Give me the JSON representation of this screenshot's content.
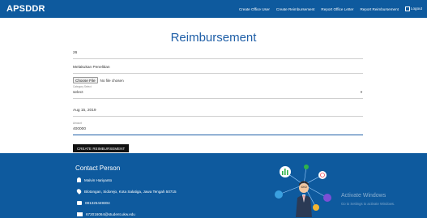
{
  "app": {
    "brand": "APSDDR"
  },
  "nav": {
    "items": [
      "Create Office User",
      "Create Reimbursement",
      "Report Office Letter",
      "Report Reimbursement"
    ],
    "logout": "Logout"
  },
  "page": {
    "title": "Reimbursement"
  },
  "form": {
    "field1_value": "26",
    "description_value": "Melakukan Penelitian",
    "file": {
      "button": "Choose File",
      "status": "No file chosen"
    },
    "category": {
      "label": "Category Select",
      "value": "select"
    },
    "date_value": "Aug 15, 2019",
    "amount": {
      "label": "Amount",
      "value": "400000"
    },
    "submit_label": "CREATE REIMBURSEMENT"
  },
  "contact": {
    "title": "Contact Person",
    "name": "Malvin Hariyanto",
    "address": "Blotongan, Sidorejo, Kota Salatiga, Jawa Tengah 50715",
    "phone": "081325449304",
    "email": "672016064@student.ukw.edu"
  },
  "watermark": {
    "line1": "Activate Windows",
    "line2": "Go to Settings to activate Windows."
  },
  "colors": {
    "primary": "#0e5a9e",
    "title": "#1f5fa7",
    "button": "#111111"
  }
}
